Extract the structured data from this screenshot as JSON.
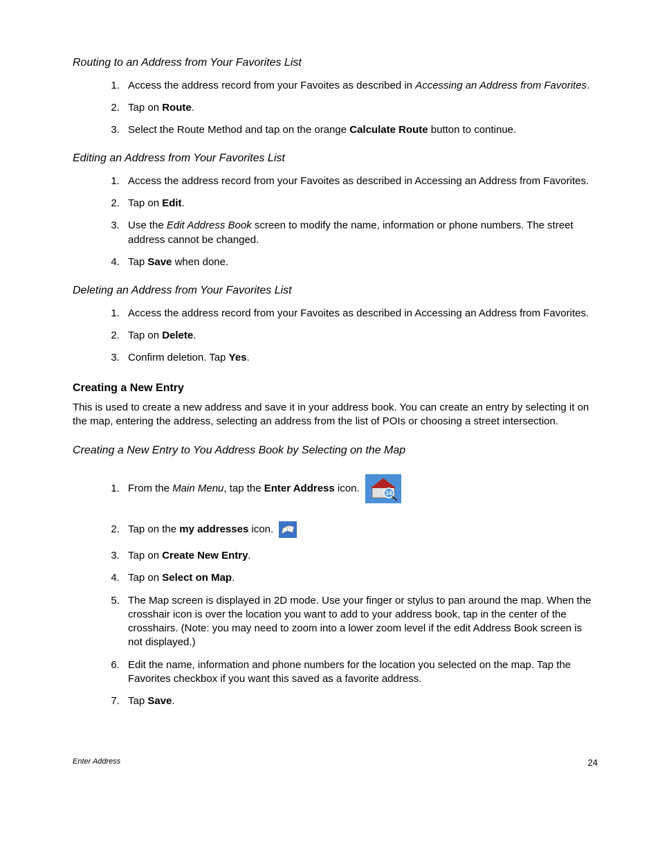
{
  "s1": {
    "title": "Routing to an Address from Your Favorites List",
    "i1a": "Access the address record from your Favoites as described in ",
    "i1b": "Accessing an Address from Favorites",
    "i1c": ".",
    "i2a": "Tap on ",
    "i2b": "Route",
    "i2c": ".",
    "i3a": "Select the Route Method and tap on the orange ",
    "i3b": "Calculate Route",
    "i3c": " button to continue."
  },
  "s2": {
    "title": "Editing an Address from Your Favorites List",
    "i1": "Access the address record from your Favoites as described in Accessing an Address from Favorites.",
    "i2a": "Tap on ",
    "i2b": "Edit",
    "i2c": ".",
    "i3a": "Use the ",
    "i3b": "Edit Address Book",
    "i3c": " screen to modify the name, information or phone numbers.  The street address cannot be changed.",
    "i4a": "Tap ",
    "i4b": "Save",
    "i4c": " when done."
  },
  "s3": {
    "title": "Deleting an Address from Your Favorites List",
    "i1": "Access the address record from your Favoites as described in Accessing an Address from Favorites.",
    "i2a": "Tap on ",
    "i2b": "Delete",
    "i2c": ".",
    "i3a": "Confirm deletion.  Tap ",
    "i3b": "Yes",
    "i3c": "."
  },
  "s4": {
    "title": "Creating a New Entry",
    "para": "This is used to create a new address and save it in your address book.  You can create an entry by selecting it on the map, entering the address, selecting an address from the list of POIs or choosing a street intersection."
  },
  "s5": {
    "title": "Creating a New Entry to You Address Book by Selecting on the Map",
    "i1a": "From the ",
    "i1b": "Main Menu",
    "i1c": ", tap the ",
    "i1d": "Enter Address",
    "i1e": " icon.",
    "i2a": "Tap on the ",
    "i2b": "my addresses",
    "i2c": " icon.",
    "i3a": "Tap on ",
    "i3b": "Create New Entry",
    "i3c": ".",
    "i4a": "Tap on ",
    "i4b": "Select on Map",
    "i4c": ".",
    "i5": "The Map screen is displayed in 2D mode.  Use your finger or stylus to pan around the map.  When the crosshair icon is over the location you want to add to your address book, tap in the center of the crosshairs.  (Note: you may need to zoom into a lower zoom level if the edit Address Book screen is not displayed.)",
    "i6": "Edit the name, information and phone numbers for the location you selected on the map.  Tap the Favorites checkbox if you want this saved as a favorite address.",
    "i7a": "Tap ",
    "i7b": "Save",
    "i7c": "."
  },
  "footer": {
    "left": "Enter Address",
    "right": "24"
  },
  "icons": {
    "enter_address": "enter-address-icon",
    "my_addresses": "my-addresses-icon"
  }
}
